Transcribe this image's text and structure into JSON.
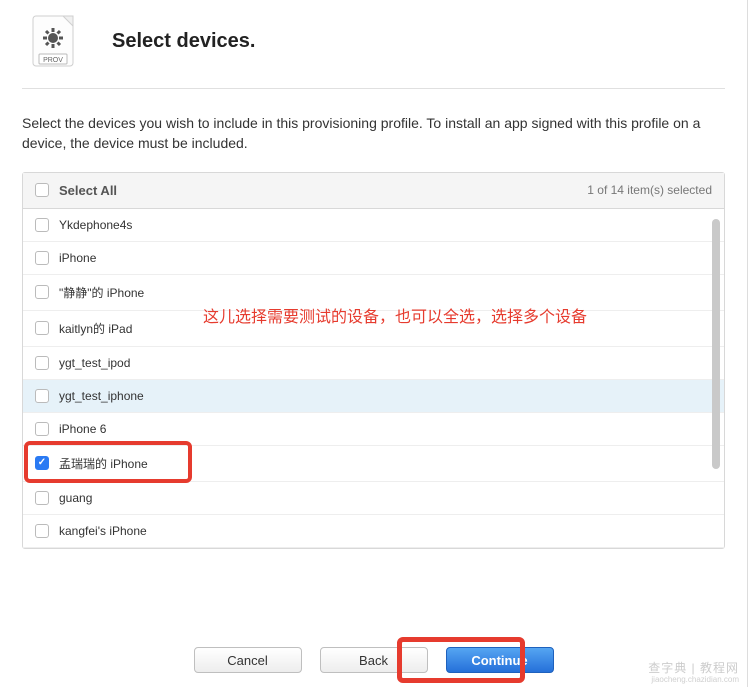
{
  "header": {
    "title": "Select devices.",
    "icon_badge": "PROV"
  },
  "instructions": "Select the devices you wish to include in this provisioning profile. To install an app signed with this profile on a device, the device must be included.",
  "select_all": {
    "label": "Select All",
    "count_text": "1  of 14 item(s) selected",
    "checked": false
  },
  "devices": [
    {
      "label": "Ykdephone4s",
      "checked": false,
      "highlighted": false
    },
    {
      "label": "iPhone",
      "checked": false,
      "highlighted": false
    },
    {
      "label": "\"静静\"的 iPhone",
      "checked": false,
      "highlighted": false
    },
    {
      "label": "kaitlyn的 iPad",
      "checked": false,
      "highlighted": false
    },
    {
      "label": "ygt_test_ipod",
      "checked": false,
      "highlighted": false
    },
    {
      "label": "ygt_test_iphone",
      "checked": false,
      "highlighted": true
    },
    {
      "label": "iPhone 6",
      "checked": false,
      "highlighted": false
    },
    {
      "label": "孟瑞瑞的 iPhone",
      "checked": true,
      "highlighted": false,
      "red_box": true
    },
    {
      "label": "guang",
      "checked": false,
      "highlighted": false
    },
    {
      "label": "kangfei's iPhone",
      "checked": false,
      "highlighted": false
    }
  ],
  "annotation": "这儿选择需要测试的设备，也可以全选，选择多个设备",
  "buttons": {
    "cancel": "Cancel",
    "back": "Back",
    "continue": "Continue"
  },
  "watermark": {
    "line1": "查字典 | 教程网",
    "line2": "jiaocheng.chazidian.com"
  }
}
